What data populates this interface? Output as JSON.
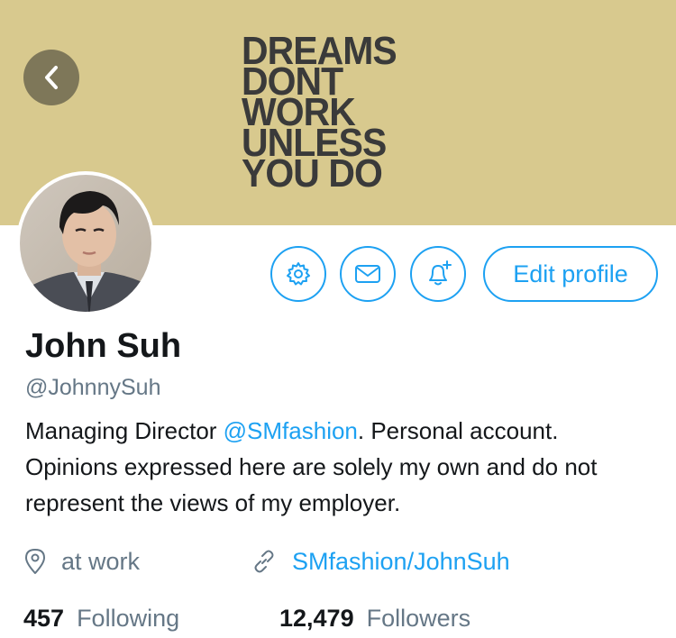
{
  "banner": {
    "lines": [
      "DREAMS",
      "DONT",
      "WORK",
      "UNLESS",
      "YOU DO"
    ],
    "background": "#d8c98e"
  },
  "header": {
    "back_icon": "chevron-left-icon"
  },
  "actions": {
    "settings_icon": "gear-icon",
    "message_icon": "envelope-icon",
    "notify_icon": "bell-plus-icon",
    "edit_profile_label": "Edit profile"
  },
  "profile": {
    "name": "John Suh",
    "handle": "@JohnnySuh",
    "bio_prefix": "Managing Director ",
    "bio_mention": "@SMfashion",
    "bio_suffix": ". Personal account. Opinions expressed here are solely my own and do not represent the views of my employer.",
    "location": "at work",
    "website": "SMfashion/JohnSuh"
  },
  "stats": {
    "following_count": "457",
    "following_label": "Following",
    "followers_count": "12,479",
    "followers_label": "Followers"
  },
  "colors": {
    "accent": "#1da1f2",
    "secondary_text": "#657786",
    "primary_text": "#14171a"
  }
}
